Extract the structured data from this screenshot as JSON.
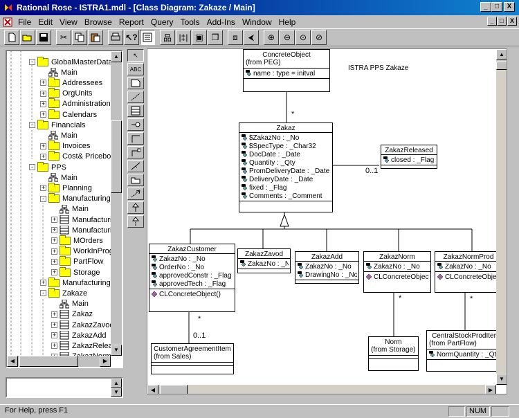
{
  "window": {
    "title": "Rational Rose - ISTRA1.mdl - [Class Diagram: Zakaze / Main]",
    "min_glyph": "_",
    "max_glyph": "□",
    "close_glyph": "X"
  },
  "menu": [
    "File",
    "Edit",
    "View",
    "Browse",
    "Report",
    "Query",
    "Tools",
    "Add-Ins",
    "Window",
    "Help"
  ],
  "tree": [
    {
      "label": "GlobalMasterData",
      "type": "folder",
      "indent": 2,
      "pm": "-"
    },
    {
      "label": "Main",
      "type": "diagram",
      "indent": 3,
      "pm": ""
    },
    {
      "label": "Addressees",
      "type": "folder",
      "indent": 3,
      "pm": "+"
    },
    {
      "label": "OrgUnits",
      "type": "folder",
      "indent": 3,
      "pm": "+"
    },
    {
      "label": "Administration",
      "type": "folder",
      "indent": 3,
      "pm": "+"
    },
    {
      "label": "Calendars",
      "type": "folder",
      "indent": 3,
      "pm": "+"
    },
    {
      "label": "Financials",
      "type": "folder",
      "indent": 2,
      "pm": "-"
    },
    {
      "label": "Main",
      "type": "diagram",
      "indent": 3,
      "pm": ""
    },
    {
      "label": "Invoices",
      "type": "folder",
      "indent": 3,
      "pm": "+"
    },
    {
      "label": "Cost& Pricebook",
      "type": "folder",
      "indent": 3,
      "pm": "+"
    },
    {
      "label": "PPS",
      "type": "folder",
      "indent": 2,
      "pm": "-"
    },
    {
      "label": "Main",
      "type": "diagram",
      "indent": 3,
      "pm": ""
    },
    {
      "label": "Planning",
      "type": "folder",
      "indent": 3,
      "pm": "+"
    },
    {
      "label": "Manufacturing",
      "type": "folder",
      "indent": 3,
      "pm": "-"
    },
    {
      "label": "Main",
      "type": "diagram",
      "indent": 4,
      "pm": ""
    },
    {
      "label": "Manufacturing",
      "type": "class",
      "indent": 4,
      "pm": "+"
    },
    {
      "label": "Manufacturing",
      "type": "class",
      "indent": 4,
      "pm": "+"
    },
    {
      "label": "MOrders",
      "type": "folder",
      "indent": 4,
      "pm": "+"
    },
    {
      "label": "WorkInProgress",
      "type": "folder",
      "indent": 4,
      "pm": "+"
    },
    {
      "label": "PartFlow",
      "type": "folder",
      "indent": 4,
      "pm": "+"
    },
    {
      "label": "Storage",
      "type": "folder",
      "indent": 4,
      "pm": "+"
    },
    {
      "label": "Manufacturing",
      "type": "folder",
      "indent": 3,
      "pm": "+"
    },
    {
      "label": "Zakaze",
      "type": "folder",
      "indent": 3,
      "pm": "-"
    },
    {
      "label": "Main",
      "type": "diagram",
      "indent": 4,
      "pm": ""
    },
    {
      "label": "Zakaz",
      "type": "class",
      "indent": 4,
      "pm": "+"
    },
    {
      "label": "ZakazZavod",
      "type": "class",
      "indent": 4,
      "pm": "+"
    },
    {
      "label": "ZakazAdd",
      "type": "class",
      "indent": 4,
      "pm": "+"
    },
    {
      "label": "ZakazReleased",
      "type": "class",
      "indent": 4,
      "pm": "+"
    },
    {
      "label": "ZakazNorm",
      "type": "class",
      "indent": 4,
      "pm": "+"
    }
  ],
  "diagram": {
    "note": "ISTRA PPS Zakaze",
    "classes": {
      "concrete": {
        "name": "ConcreteObject",
        "from": "(from PEG)",
        "attrs": [
          "name : type = initval"
        ],
        "ops": []
      },
      "zakaz": {
        "name": "Zakaz",
        "attrs": [
          "$ZakazNo : _No",
          "$SpecType : _Char32",
          "DocDate : _Date",
          "Quantity : _Qty",
          "PromDeliveryDate : _Date",
          "DeliveryDate : _Date",
          "fixed : _Flag",
          "Comments : _Comment"
        ],
        "ops": []
      },
      "released": {
        "name": "ZakazReleased",
        "attrs": [
          "closed : _Flag"
        ],
        "ops": []
      },
      "customer": {
        "name": "ZakazCustomer",
        "attrs": [
          "ZakazNo : _No",
          "OrderNo : _No",
          "approvedConstr : _Flag",
          "approvedTech : _Flag"
        ],
        "ops": [
          "CLConcreteObject()"
        ]
      },
      "zavod": {
        "name": "ZakazZavod",
        "attrs": [
          "ZakazNo : _No"
        ],
        "ops": []
      },
      "add": {
        "name": "ZakazAdd",
        "attrs": [
          "ZakazNo : _No",
          "DrawingNo : _No"
        ],
        "ops": []
      },
      "norm": {
        "name": "ZakazNorm",
        "attrs": [
          "ZakazNo : _No"
        ],
        "ops": [
          "CLConcreteObject()"
        ]
      },
      "normprod": {
        "name": "ZakazNormProd",
        "attrs": [
          "ZakazNo : _No"
        ],
        "ops": [
          "CLConcreteObject()"
        ]
      },
      "agreement": {
        "name": "CustomerAgreementItem",
        "from": "(from Sales)",
        "attrs": [],
        "ops": []
      },
      "normstorage": {
        "name": "Norm",
        "from": "(from Storage)",
        "attrs": [],
        "ops": []
      },
      "central": {
        "name": "CentralStockProdItem",
        "from": "(from PartFlow)",
        "attrs": [
          "NormQuantity : _Qty"
        ],
        "ops": []
      }
    },
    "multiplicities": {
      "m1": "*",
      "m2": "0..1",
      "m3": "*",
      "m4": "0..1",
      "m5": "*",
      "m6": "*"
    }
  },
  "status": {
    "help": "For Help, press F1",
    "num": "NUM"
  }
}
